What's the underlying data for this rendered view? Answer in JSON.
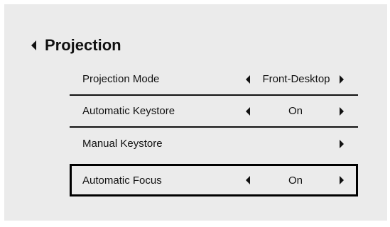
{
  "menu": {
    "title": "Projection",
    "items": [
      {
        "label": "Projection Mode",
        "value": "Front-Desktop",
        "has_left_arrow": true,
        "has_right_arrow": true
      },
      {
        "label": "Automatic Keystore",
        "value": "On",
        "has_left_arrow": true,
        "has_right_arrow": true
      },
      {
        "label": "Manual Keystore",
        "value": "",
        "has_left_arrow": false,
        "has_right_arrow": true
      },
      {
        "label": "Automatic Focus",
        "value": "On",
        "has_left_arrow": true,
        "has_right_arrow": true,
        "selected": true
      }
    ]
  },
  "colors": {
    "panel_background": "#ebebeb",
    "text": "#111111",
    "selection_border": "#000000"
  }
}
